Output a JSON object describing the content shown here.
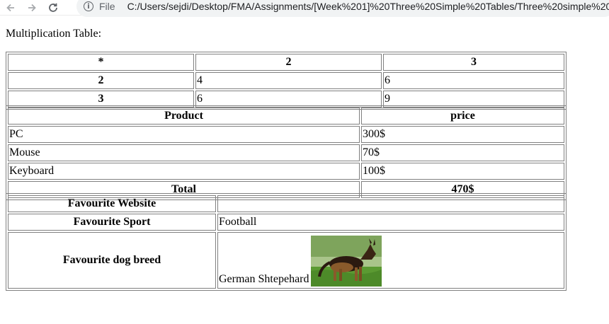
{
  "browser": {
    "scheme_label": "File",
    "url": "C:/Users/sejdi/Desktop/FMA/Assignments/[Week%201]%20Three%20Simple%20Tables/Three%20simple%20ta"
  },
  "page": {
    "caption": "Multiplication Table:",
    "multiplication": {
      "header": [
        "*",
        "2",
        "3"
      ],
      "rows": [
        {
          "label": "2",
          "cells": [
            "4",
            "6"
          ]
        },
        {
          "label": "3",
          "cells": [
            "6",
            "9"
          ]
        }
      ]
    },
    "products": {
      "header": [
        "Product",
        "price"
      ],
      "rows": [
        [
          "PC",
          "300$"
        ],
        [
          "Mouse",
          "70$"
        ],
        [
          "Keyboard",
          "100$"
        ]
      ],
      "total_label": "Total",
      "total_value": "470$"
    },
    "favourites": {
      "website_label": "Favourite Website",
      "website_value": "",
      "sport_label": "Favourite Sport",
      "sport_value": "Football",
      "dog_label": "Favourite dog breed",
      "dog_value": "German Shtepehard",
      "dog_image": "german-shepherd-photo"
    }
  }
}
